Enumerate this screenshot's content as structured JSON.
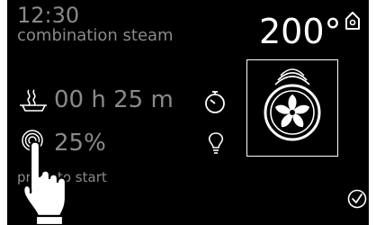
{
  "status": {
    "time": "12:30",
    "program": "combination steam",
    "temperature": "200°"
  },
  "settings": {
    "duration": "00 h 25 m",
    "humidity": "25%"
  },
  "hint": "press to start",
  "icons": {
    "home": "home-icon",
    "steam_tray": "steam-tray-icon",
    "steam": "steam-icon",
    "timer": "stopwatch-icon",
    "lamp": "lamp-icon",
    "fan": "fan-icon",
    "confirm": "check-icon",
    "hand": "hand-pointer-icon"
  },
  "colors": {
    "background": "#000000",
    "text_primary": "#ffffff",
    "text_secondary": "#8a8a8a"
  }
}
